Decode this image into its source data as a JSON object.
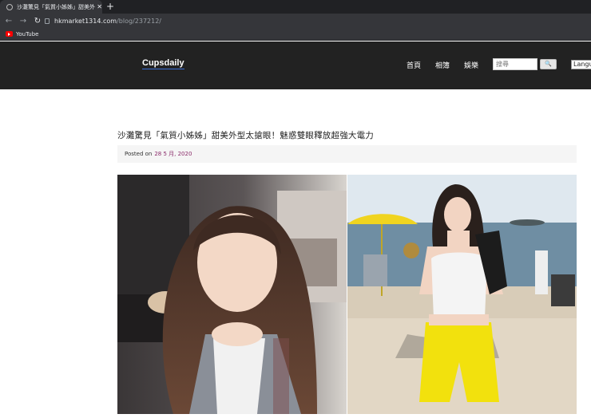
{
  "browser": {
    "tab_title": "沙灘驚見「氣質小姊姊」甜美外型太...",
    "url_host": "hkmarket1314.com",
    "url_path": "/blog/237212/",
    "bookmark": "YouTube"
  },
  "site": {
    "brand": "Cupsdaily",
    "nav": [
      "首頁",
      "相簿",
      "娛樂"
    ],
    "search_placeholder": "搜尋",
    "search_button": "🔍",
    "language": "Language"
  },
  "article": {
    "title": "沙灘驚見「氣質小姊姊」甜美外型太搶眼！魅惑雙眼釋放超強大電力",
    "posted_on_label": "Posted on",
    "posted_date": "28 5 月, 2020"
  }
}
